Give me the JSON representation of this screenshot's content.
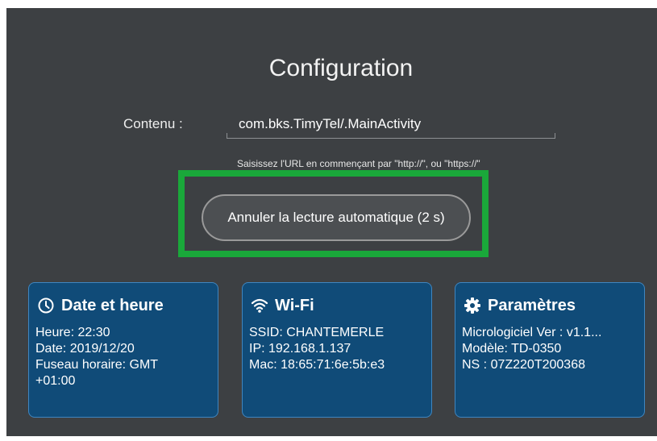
{
  "config": {
    "title": "Configuration",
    "content_label": "Contenu :",
    "content_value": "com.bks.TimyTel/.MainActivity",
    "hint": "Saisissez l'URL en commençant par \"http://\", ou \"https://\""
  },
  "cancel_button": {
    "label": "Annuler la lecture automatique (2 s)"
  },
  "cards": {
    "datetime": {
      "title": "Date et heure",
      "icon": "clock-icon",
      "lines": [
        "Heure: 22:30",
        "Date: 2019/12/20",
        "Fuseau horaire: GMT",
        "+01:00"
      ]
    },
    "wifi": {
      "title": "Wi-Fi",
      "icon": "wifi-icon",
      "lines": [
        "SSID: CHANTEMERLE",
        "IP: 192.168.1.137",
        "Mac: 18:65:71:6e:5b:e3"
      ]
    },
    "params": {
      "title": "Paramètres",
      "icon": "gear-icon",
      "lines": [
        "Micrologiciel Ver : v1.1...",
        "Modèle: TD-0350",
        "NS : 07Z220T200368"
      ]
    }
  },
  "colors": {
    "background": "#3d4043",
    "card": "#104b78",
    "highlight": "#1aa83a"
  }
}
